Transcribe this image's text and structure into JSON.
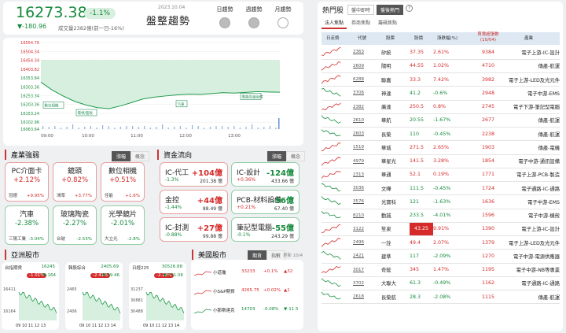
{
  "header": {
    "index_value": "16273.38",
    "change_pct": "-1.1%",
    "change_value": "▼-180.96",
    "volume": "成交量2382億(前一日-16%)",
    "date": "2023.10.04",
    "title": "盤整趨勢",
    "periods": [
      {
        "label": "日趨勢"
      },
      {
        "label": "週趨勢"
      },
      {
        "label": "月趨勢"
      }
    ]
  },
  "chart": {
    "y_ticks": [
      "16554.76",
      "16504.34",
      "16454.34",
      "16403.82",
      "16353.84",
      "16303.36",
      "16253.34",
      "16203.36",
      "16153.24",
      "16102.96",
      "16063.64"
    ],
    "x_ticks": [
      "09:00",
      "10:00",
      "11:00",
      "12:00",
      "13:00"
    ],
    "annotations": [
      "數位相機",
      "筆記型電腦",
      "汽車",
      "電腦周邊設備",
      "電視/面板"
    ]
  },
  "chart_data": {
    "type": "line",
    "y_ticks": [
      16554.76,
      16504.34,
      16454.34,
      16403.82,
      16353.84,
      16303.36,
      16253.34,
      16203.36,
      16153.24,
      16102.96,
      16063.64
    ],
    "x_ticks": [
      "09:00",
      "10:00",
      "11:00",
      "12:00",
      "13:00"
    ],
    "reference": 16454.34,
    "series": [
      {
        "values": [
          16330,
          16285,
          16250,
          16220,
          16200,
          16185,
          16180,
          16195,
          16215,
          16235,
          16245,
          16252,
          16258,
          16262,
          16260,
          16265,
          16270,
          16268,
          16272,
          16276,
          16274,
          16273
        ]
      }
    ]
  },
  "industry": {
    "title": "產業強弱",
    "toggle": [
      "漲幅",
      "概念"
    ],
    "cards": [
      {
        "name": "PC介面卡",
        "pct": "+2.12%",
        "leader": "冠德",
        "lpct": "+9.95%",
        "color": "red"
      },
      {
        "name": "鏡頭",
        "pct": "+0.82%",
        "leader": "鴻準",
        "lpct": "+3.77%",
        "color": "red"
      },
      {
        "name": "數位相機",
        "pct": "+0.51%",
        "leader": "佳能",
        "lpct": "+1.6%",
        "color": "red"
      },
      {
        "name": "汽車",
        "pct": "-2.38%",
        "leader": "三陽工業",
        "lpct": "-3.04%",
        "color": "grn"
      },
      {
        "name": "玻璃陶瓷",
        "pct": "-2.27%",
        "leader": "台玻",
        "lpct": "-2.53%",
        "color": "grn"
      },
      {
        "name": "光學鏡片",
        "pct": "-2.01%",
        "leader": "大立光",
        "lpct": "-2.8%",
        "color": "grn"
      }
    ]
  },
  "capital": {
    "title": "資金流向",
    "toggle": [
      "漲幅",
      "概念"
    ],
    "items": [
      {
        "name": "IC-代工",
        "pct": "-1.3%",
        "amount": "+104億",
        "total": "201.38 億",
        "color": "red"
      },
      {
        "name": "IC-設計",
        "pct": "+0.36%",
        "amount": "-124億",
        "total": "433.66 億",
        "color": "grn"
      },
      {
        "name": "金控",
        "pct": "-1.44%",
        "amount": "+44億",
        "total": "88.49 億",
        "color": "red"
      },
      {
        "name": "PCB-材料設備",
        "pct": "+0.21%",
        "amount": "-56億",
        "total": "67.40 億",
        "color": "grn"
      },
      {
        "name": "IC-封測",
        "pct": "-0.88%",
        "amount": "+27億",
        "total": "99.88 億",
        "color": "red"
      },
      {
        "name": "筆記型電腦",
        "pct": "-0.1%",
        "amount": "-55億",
        "total": "243.29 億",
        "color": "grn"
      }
    ]
  },
  "asia": {
    "title": "亞洲股市",
    "cards": [
      {
        "name": "台指期貨",
        "value": "16245",
        "pct": "-1.01%",
        "chg": "▼-164",
        "ticks": [
          "16411",
          "16164"
        ],
        "x": "09  10  11  12  13"
      },
      {
        "name": "韓股綜合",
        "value": "2405.69",
        "pct": "-2.41%",
        "chg": "▼-59.46",
        "ticks": [
          "2465",
          "2406"
        ],
        "x": "09  10  11  12  13  14"
      },
      {
        "name": "日經225",
        "value": "30526.88",
        "pct": "-2.28%",
        "chg": "▼-711.06",
        "ticks": [
          "31237",
          "30881",
          "30488"
        ],
        "x": "09  10  11  12  13  14"
      }
    ]
  },
  "us": {
    "title": "美國股市",
    "toggle": [
      "期貨",
      "指數"
    ],
    "updated": "更新 10/4",
    "rows": [
      {
        "name": "小道瓊",
        "value": "33233",
        "pct": "+0.1%",
        "chg": "▲32",
        "color": "red"
      },
      {
        "name": "小S&P期貨",
        "value": "4265.75",
        "pct": "+0.02%",
        "chg": "▲1",
        "color": "red"
      },
      {
        "name": "小那斯達克",
        "value": "14703",
        "pct": "-0.08%",
        "chg": "▼-11.5",
        "color": "grn"
      }
    ]
  },
  "hot": {
    "title": "熱門股",
    "tabs": [
      "盤中即時",
      "盤後熱門"
    ],
    "subtabs": [
      "法人焦點",
      "券商焦點",
      "籌碼焦點"
    ],
    "columns": [
      "日走勢",
      "代號",
      "股票",
      "股價",
      "漲跌幅(%)",
      "買賣超張數(10/04)",
      "產業"
    ],
    "rows": [
      {
        "code": "2363",
        "name": "矽統",
        "price": "37.35",
        "pct": "2.61%",
        "vol": "9384",
        "ind": "電子上游-IC-設計",
        "dir": "up"
      },
      {
        "code": "2609",
        "name": "陽明",
        "price": "44.55",
        "pct": "1.02%",
        "vol": "4710",
        "ind": "傳產-航運",
        "dir": "up"
      },
      {
        "code": "6288",
        "name": "聯嘉",
        "price": "33.3",
        "pct": "7.42%",
        "vol": "3982",
        "ind": "電子上游-LED及光元件",
        "dir": "up"
      },
      {
        "code": "3706",
        "name": "神達",
        "price": "41.2",
        "pct": "-0.6%",
        "vol": "2948",
        "ind": "電子中游-EMS",
        "dir": "dn"
      },
      {
        "code": "2382",
        "name": "廣達",
        "price": "250.5",
        "pct": "0.8%",
        "vol": "2745",
        "ind": "電子下游-筆記型電腦",
        "dir": "up"
      },
      {
        "code": "2610",
        "name": "華航",
        "price": "20.55",
        "pct": "-1.67%",
        "vol": "2677",
        "ind": "傳產-航運",
        "dir": "dn"
      },
      {
        "code": "2603",
        "name": "長榮",
        "price": "110",
        "pct": "-0.45%",
        "vol": "2238",
        "ind": "傳產-航運",
        "dir": "dn"
      },
      {
        "code": "1519",
        "name": "華城",
        "price": "271.5",
        "pct": "2.65%",
        "vol": "1903",
        "ind": "傳產-電機",
        "dir": "up"
      },
      {
        "code": "4979",
        "name": "華星光",
        "price": "141.5",
        "pct": "3.28%",
        "vol": "1854",
        "ind": "電子中游-通訊設備",
        "dir": "up"
      },
      {
        "code": "2313",
        "name": "華通",
        "price": "52.1",
        "pct": "0.19%",
        "vol": "1771",
        "ind": "電子上游-PCB-製造",
        "dir": "up"
      },
      {
        "code": "3036",
        "name": "文曄",
        "price": "111.5",
        "price2": "",
        "pct": "-0.45%",
        "vol": "1724",
        "ind": "電子通路-IC-通路",
        "dir": "dn"
      },
      {
        "code": "3576",
        "name": "光寶科",
        "price": "121",
        "pct": "-1.63%",
        "vol": "1636",
        "ind": "電子中游-EMS",
        "dir": "dn"
      },
      {
        "code": "8210",
        "name": "勤誠",
        "price": "233.5",
        "pct": "-4.01%",
        "vol": "1596",
        "ind": "電子中游-機殼",
        "dir": "dn"
      },
      {
        "code": "3122",
        "name": "笙泉",
        "price": "43.25",
        "pct": "9.91%",
        "vol": "1390",
        "ind": "電子上游-IC-設計",
        "dir": "up",
        "limit": true
      },
      {
        "code": "2496",
        "name": "一詮",
        "price": "49.4",
        "pct": "2.07%",
        "vol": "1379",
        "ind": "電子上游-LED及光元件",
        "dir": "up"
      },
      {
        "code": "2421",
        "name": "建準",
        "price": "117",
        "pct": "-2.09%",
        "vol": "1270",
        "ind": "電子中游-電源供應器",
        "dir": "dn"
      },
      {
        "code": "3017",
        "name": "奇鋐",
        "price": "345",
        "pct": "1.47%",
        "vol": "1195",
        "ind": "電子中游-NB等專業",
        "dir": "up"
      },
      {
        "code": "3702",
        "name": "大聯大",
        "price": "61.3",
        "pct": "-0.49%",
        "vol": "1162",
        "ind": "電子通路-IC-通路",
        "dir": "dn"
      },
      {
        "code": "2618",
        "name": "長榮航",
        "price": "28.3",
        "pct": "-2.08%",
        "vol": "1115",
        "ind": "傳產-航運",
        "dir": "dn"
      }
    ]
  }
}
